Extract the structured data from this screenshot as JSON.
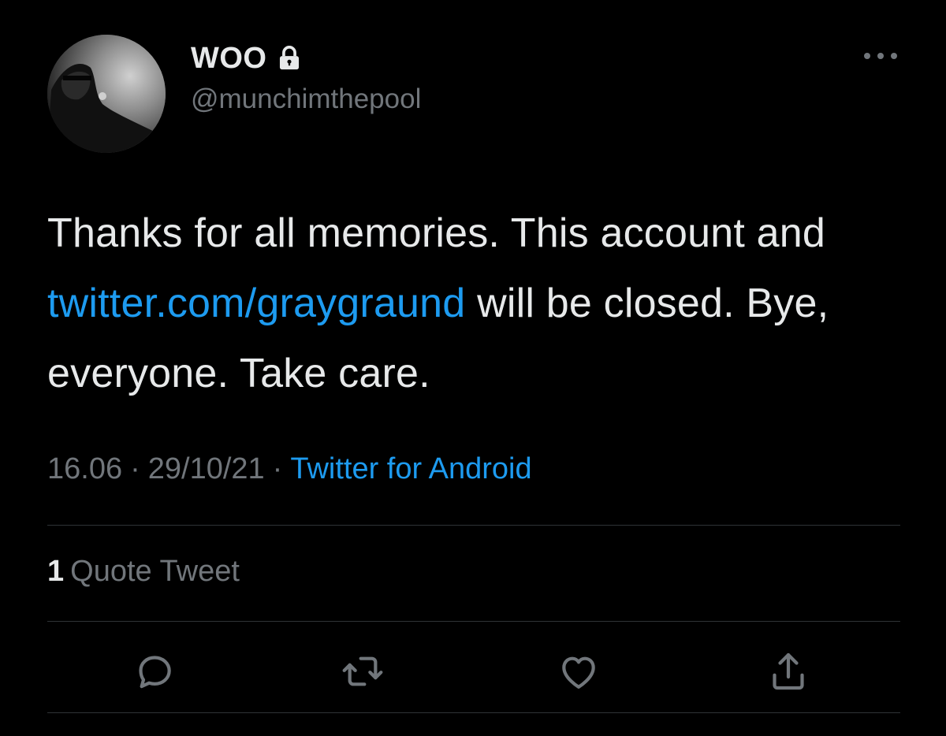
{
  "user": {
    "display_name": "WOO",
    "handle": "@munchimthepool",
    "protected_icon": "lock-icon",
    "avatar_icon": "avatar-photo"
  },
  "menu": {
    "more_icon": "more-horizontal-icon"
  },
  "tweet": {
    "text_before": "Thanks for all memories. This account and ",
    "link_text": "twitter.com/graygraund",
    "text_after": " will be closed. Bye, everyone. Take care."
  },
  "meta": {
    "time": "16.06",
    "separator": "·",
    "date": "29/10/21",
    "source": "Twitter for Android"
  },
  "stats": {
    "quote_count": "1",
    "quote_label": "Quote Tweet"
  },
  "actions": {
    "reply_icon": "reply-icon",
    "retweet_icon": "retweet-icon",
    "like_icon": "heart-icon",
    "share_icon": "share-icon"
  },
  "colors": {
    "background": "#000000",
    "text": "#e7e9ea",
    "secondary": "#71767b",
    "link": "#1d9bf0",
    "divider": "#2f3336"
  }
}
